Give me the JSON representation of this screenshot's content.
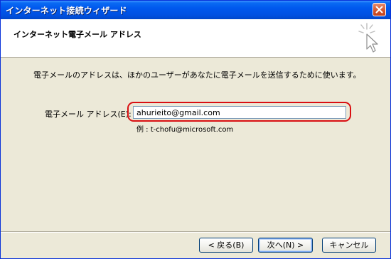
{
  "window": {
    "title": "インターネット接続ウィザード",
    "close_icon": "close-icon"
  },
  "header": {
    "title": "インターネット電子メール アドレス",
    "icon": "wizard-cursor-icon"
  },
  "body": {
    "description": "電子メールのアドレスは、ほかのユーザーがあなたに電子メールを送信するために使います。",
    "email_label": "電子メール アドレス(E):",
    "email_value": "ahurieito@gmail.com",
    "email_example": "例 : t-chofu@microsoft.com"
  },
  "buttons": {
    "back": "< 戻る(B)",
    "next": "次へ(N) >",
    "cancel": "キャンセル"
  },
  "colors": {
    "titlebar": "#0058EE",
    "dialog_bg": "#ECE9D8",
    "highlight": "#D90F12"
  }
}
